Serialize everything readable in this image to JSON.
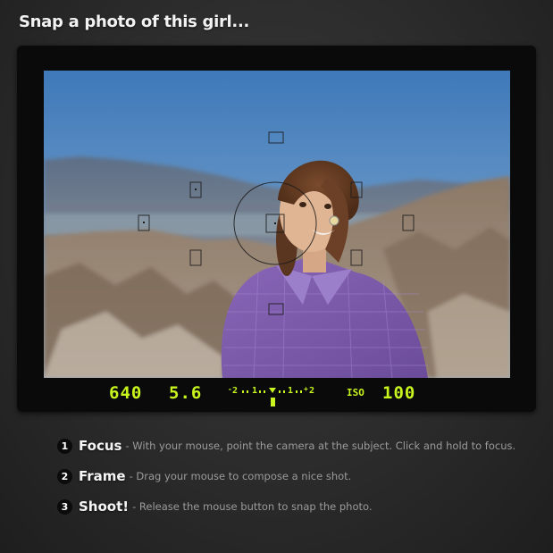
{
  "header": {
    "title": "Snap a photo of this girl..."
  },
  "viewfinder": {
    "shutter_speed": "640",
    "aperture": "5.6",
    "exposure_scale": {
      "labels": [
        "2",
        "1",
        "1",
        "2"
      ],
      "signs": [
        "-",
        "+"
      ],
      "exposure_compensation": 0
    },
    "iso_label": "ISO",
    "iso_value": "100"
  },
  "instructions": [
    {
      "number": "1",
      "title": "Focus",
      "description": "- With your mouse, point the camera at the subject. Click and hold to focus."
    },
    {
      "number": "2",
      "title": "Frame",
      "description": "- Drag your mouse to compose a nice shot."
    },
    {
      "number": "3",
      "title": "Shoot!",
      "description": "- Release the mouse button to snap the photo."
    }
  ],
  "colors": {
    "readout": "#c8f51e",
    "background": "#2b2b2b",
    "camera_body": "#0a0a0a"
  }
}
